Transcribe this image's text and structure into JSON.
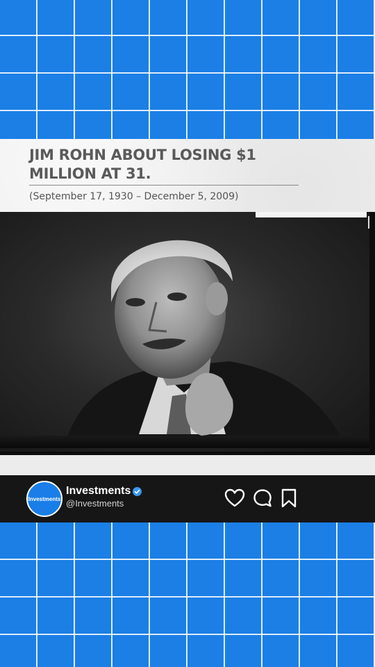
{
  "post": {
    "headline": "JIM ROHN ABOUT LOSING $1 MILLION AT 31.",
    "dates": "(September 17, 1930 – December 5, 2009)"
  },
  "video": {
    "subject": "black-and-white-video-frame"
  },
  "profile": {
    "avatar_text": "Investments",
    "name": "Investments",
    "handle": "@Investments",
    "verified": true
  },
  "actions": {
    "like_icon": "heart-icon",
    "comment_icon": "comment-icon",
    "save_icon": "bookmark-icon"
  },
  "colors": {
    "background_blue": "#1b7fe6",
    "grid_lines": "#ffffff",
    "card_bg": "#efefef",
    "headline_text": "#5a5a5a",
    "profile_bar_bg": "#161616",
    "verified_blue": "#3897f0"
  }
}
